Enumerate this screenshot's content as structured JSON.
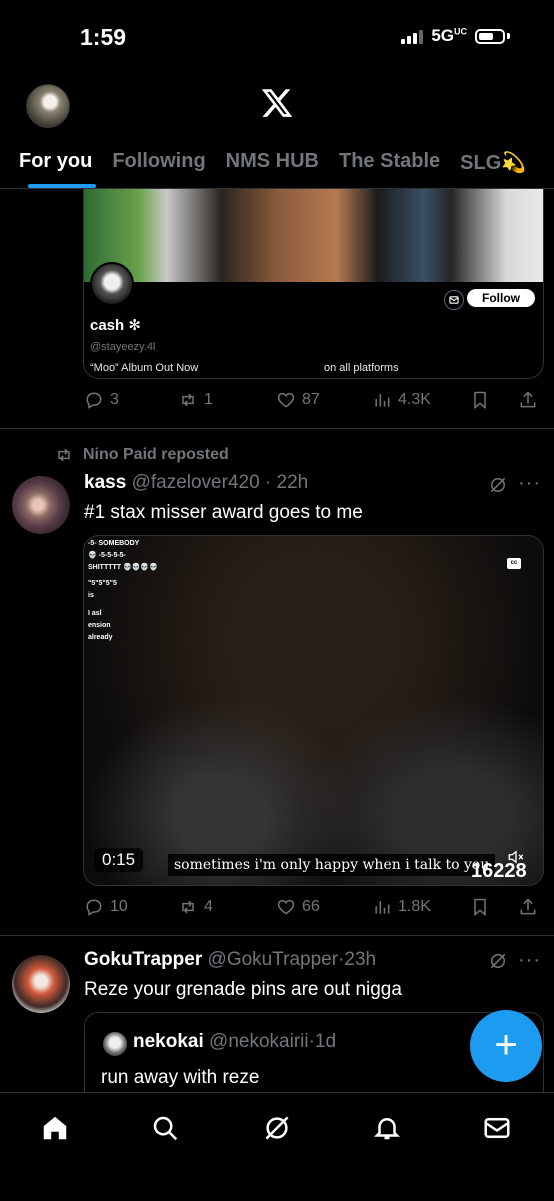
{
  "status_bar": {
    "time": "1:59",
    "network": "5G",
    "network_suffix": "UC"
  },
  "header": {
    "logo": "x-logo"
  },
  "tabs": [
    {
      "label": "For you",
      "active": true
    },
    {
      "label": "Following",
      "active": false
    },
    {
      "label": "NMS HUB",
      "active": false
    },
    {
      "label": "The Stable",
      "active": false
    },
    {
      "label": "SLG💫",
      "active": false
    }
  ],
  "post1": {
    "card": {
      "name": "cash ✻",
      "handle": "@stayeezy.4l",
      "bio_left": "“Moo” Album Out Now",
      "bio_right": "on all platforms",
      "follow_label": "Follow"
    },
    "actions": {
      "replies": "3",
      "reposts": "1",
      "likes": "87",
      "views": "4.3K"
    }
  },
  "post2": {
    "repost_label": "Nino Paid reposted",
    "name": "kass",
    "handle": "@fazelover420",
    "time": "22h",
    "text": "#1 stax misser award goes to me",
    "video": {
      "overlay_text": [
        "-5- SOMEBODY",
        "💀 -5-5-5-5-",
        "SHITTTTT 💀💀💀💀",
        "\"5\"5\"5\"5",
        "is",
        "I asl",
        "ension",
        "already"
      ],
      "cc": "cc",
      "time": "0:15",
      "caption": "sometimes i'm only happy when i talk to you",
      "watermark": "16228"
    },
    "actions": {
      "replies": "10",
      "reposts": "4",
      "likes": "66",
      "views": "1.8K"
    }
  },
  "post3": {
    "name": "GokuTrapper",
    "handle": "@GokuTrapper",
    "time": "23h",
    "text": "Reze your grenade pins are out nigga",
    "quote": {
      "name": "nekokai",
      "handle": "@nekokairii",
      "time": "1d",
      "text": "run away with reze"
    }
  },
  "fab_label": "+",
  "colors": {
    "accent": "#1d9bf0",
    "muted": "#71767b",
    "border": "#2f3336"
  }
}
